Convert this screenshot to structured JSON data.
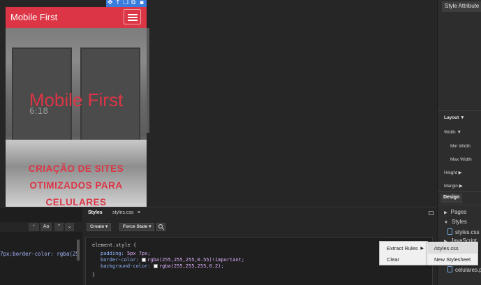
{
  "phone": {
    "brand": "Mobile First",
    "hero_title": "Mobile First",
    "hero_sub_lines": [
      "CRIAÇÃO DE SITES",
      "OTIMIZADOS PARA",
      "CELULARES"
    ],
    "time": "6:18",
    "accent": "#dc3545"
  },
  "right_panel": {
    "style_attribute": "Style Attribute",
    "layout": "Layout",
    "width": "Width",
    "min_width": "Min Width",
    "max_width": "Max Width",
    "height": "Height",
    "margin": "Margin",
    "design_tab": "Design",
    "tree": {
      "pages": "Pages",
      "styles": "Styles",
      "styles_file": "styles.css",
      "javascript": "JavaScript",
      "image_file": "celulares.p"
    }
  },
  "left_bottom": {
    "aa_label": "Aa",
    "code_snippet": "7px;border-color: rgba(255,255,25"
  },
  "styles_panel": {
    "tabs": [
      "Styles",
      "styles.css"
    ],
    "create_label": "Create",
    "force_state_label": "Force State",
    "selector": "element.style {",
    "padding_prop": "padding:",
    "padding_val": "5px 7px;",
    "border_prop": "border-color:",
    "border_val": "rgba(255,255,255,0.55)!important;",
    "bg_prop": "background-color:",
    "bg_val": "rgba(255,255,255,0.2);",
    "close_brace": "}"
  },
  "context_menu": {
    "extract_rules": "Extract Rules",
    "clear": "Clear",
    "submenu": [
      "/styles.css",
      "New Stylesheet"
    ]
  }
}
